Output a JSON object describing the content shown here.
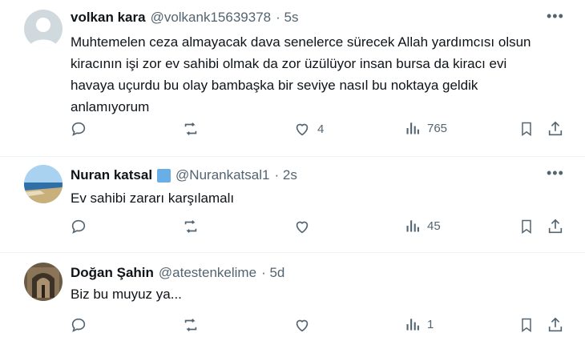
{
  "tweets": [
    {
      "name": "volkan kara",
      "handle": "@volkank15639378",
      "time": "· 5s",
      "verified": false,
      "text": "Muhtemelen ceza almayacak dava senelerce sürecek Allah yardımcısı olsun kiracının işi zor ev sahibi olmak da zor üzülüyor insan bursa da kiracı evi havaya uçurdu bu olay bambaşka bir seviye nasıl bu noktaya geldik anlamıyorum",
      "likes": "4",
      "views": "765"
    },
    {
      "name": "Nuran katsal",
      "handle": "@Nurankatsal1",
      "time": "· 2s",
      "verified": true,
      "text": "Ev sahibi zararı karşılamalı",
      "likes": "",
      "views": "45"
    },
    {
      "name": "Doğan Şahin",
      "handle": "@atestenkelime",
      "time": "· 5d",
      "verified": false,
      "text": "Biz bu muyuz ya...",
      "likes": "",
      "views": "1"
    }
  ],
  "icons": {
    "reply": "reply-icon",
    "retweet": "retweet-icon",
    "like": "heart-icon",
    "views": "views-icon",
    "bookmark": "bookmark-icon",
    "share": "share-icon",
    "more": "more-icon"
  },
  "colors": {
    "text": "#0f1419",
    "secondary": "#536471",
    "verified": "#6aaee8",
    "divider": "#eff3f4"
  }
}
